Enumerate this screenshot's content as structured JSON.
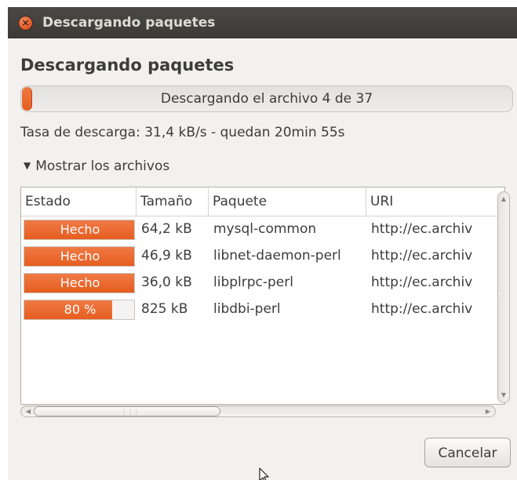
{
  "window": {
    "title": "Descargando paquetes",
    "close_icon": "close-icon"
  },
  "heading": "Descargando paquetes",
  "progress": {
    "text": "Descargando el archivo 4 de 37",
    "fraction": 0.02,
    "color": "#e65d1f"
  },
  "rate_text": "Tasa de descarga: 31,4 kB/s - quedan 20min 55s",
  "expander": {
    "label": "Mostrar los archivos",
    "expanded": true,
    "icon": "triangle-down-icon"
  },
  "table": {
    "columns": [
      "Estado",
      "Tamaño",
      "Paquete",
      "URI"
    ],
    "rows": [
      {
        "status": "Hecho",
        "status_fraction": 1.0,
        "size": "64,2 kB",
        "package": "mysql-common",
        "uri": "http://ec.archiv"
      },
      {
        "status": "Hecho",
        "status_fraction": 1.0,
        "size": "46,9 kB",
        "package": "libnet-daemon-perl",
        "uri": "http://ec.archiv"
      },
      {
        "status": "Hecho",
        "status_fraction": 1.0,
        "size": "36,0 kB",
        "package": "libplrpc-perl",
        "uri": "http://ec.archiv"
      },
      {
        "status": "80 %",
        "status_fraction": 0.8,
        "size": "825 kB",
        "package": "libdbi-perl",
        "uri": "http://ec.archiv"
      }
    ]
  },
  "buttons": {
    "cancel": "Cancelar"
  },
  "colors": {
    "accent": "#e65d1f",
    "titlebar": "#3c3b37",
    "window_bg": "#f2f1f0"
  }
}
